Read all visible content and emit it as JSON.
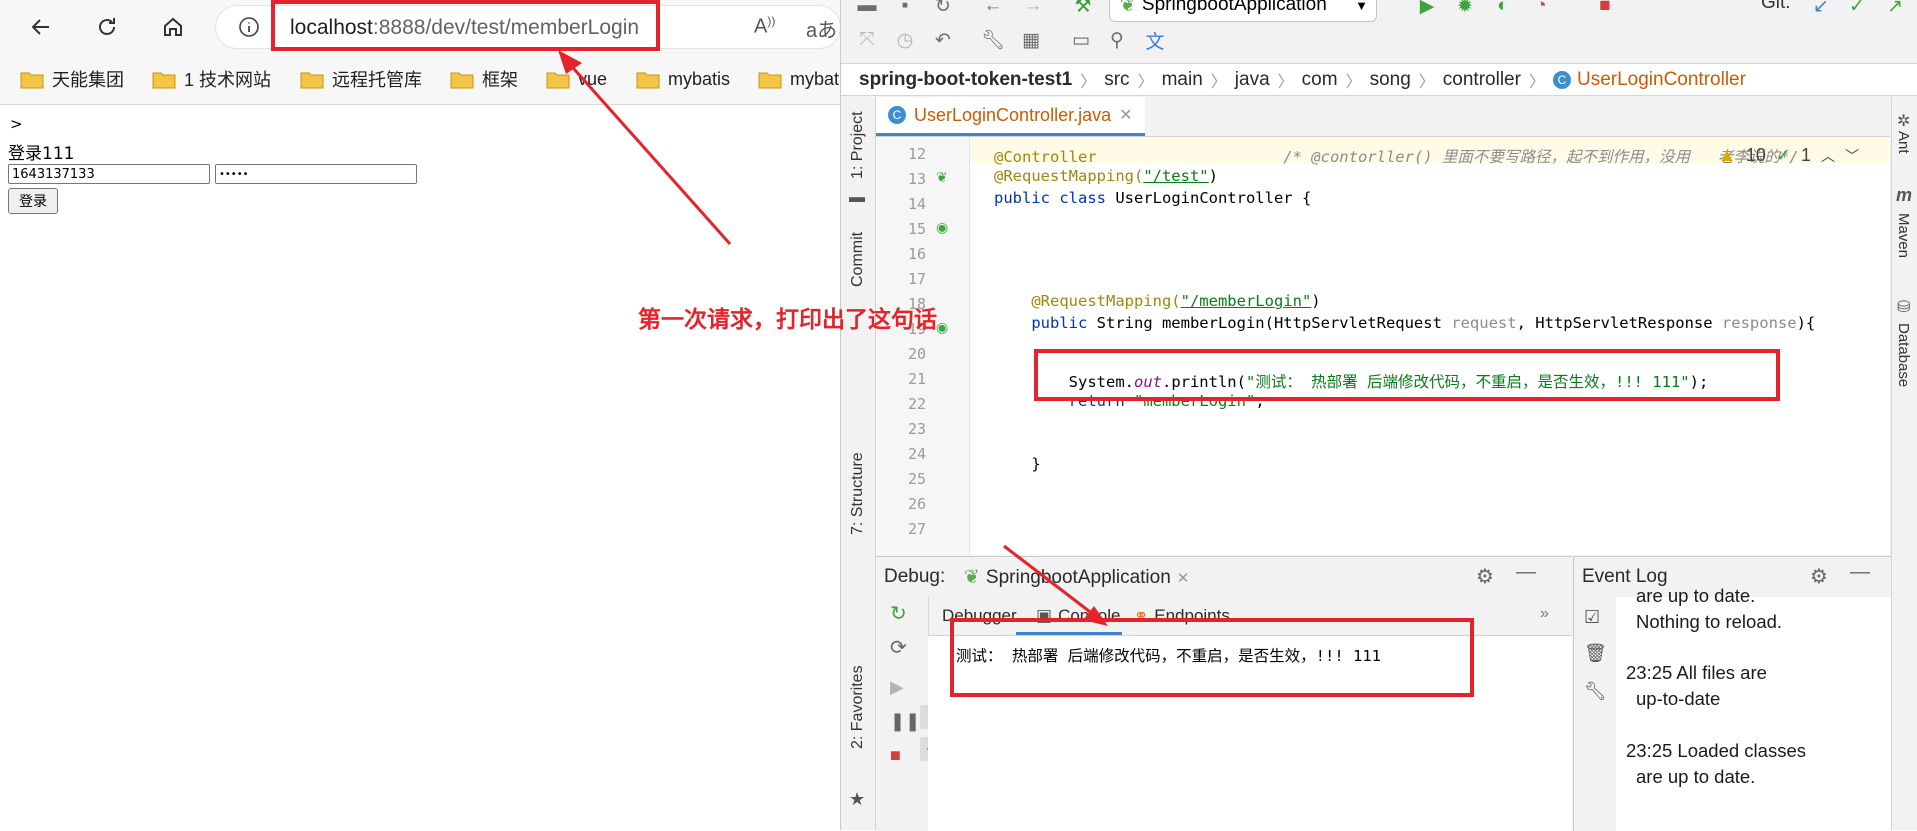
{
  "browser": {
    "address": {
      "host": "localhost",
      "path": ":8888/dev/test/memberLogin"
    },
    "bookmarks": [
      "天能集团",
      "1 技术网站",
      "远程托管库",
      "框架",
      "vue",
      "mybatis",
      "mybat"
    ],
    "page": {
      "caret": ">",
      "heading": "登录111",
      "username_value": "1643137133",
      "password_value": "•••••",
      "submit_label": "登录"
    }
  },
  "ide": {
    "run_config": "SpringbootApplication",
    "git_label": "Git:",
    "breadcrumbs": [
      "spring-boot-token-test1",
      "src",
      "main",
      "java",
      "com",
      "song",
      "controller",
      "UserLoginController"
    ],
    "left_tabs": [
      "1: Project",
      "Commit",
      "7: Structure",
      "2: Favorites"
    ],
    "right_tabs": [
      "Ant",
      "Maven",
      "Database"
    ],
    "file_tab": "UserLoginController.java",
    "inspections": {
      "warnings": "10",
      "checks": "1"
    },
    "line_numbers": [
      "12",
      "13",
      "14",
      "15",
      "16",
      "17",
      "18",
      "19",
      "20",
      "21",
      "22",
      "23",
      "24",
      "25",
      "26",
      "27"
    ],
    "code": {
      "l13_ann": "@Controller",
      "l13_comment": "/* @contorller() 里面不要写路径，起不到作用，没用   老李说的*/",
      "l14_ann": "@RequestMapping(",
      "l14_str": "\"/test\"",
      "l14_end": ")",
      "l15_kw": "public class ",
      "l15_rest": "UserLoginController {",
      "l18_ann": "@RequestMapping(",
      "l18_str": "\"/memberLogin\"",
      "l18_end": ")",
      "l19_kw": "public ",
      "l19_a": "String memberLogin(HttpServletRequest ",
      "l19_p1": "request",
      "l19_b": ", HttpServletResponse ",
      "l19_p2": "response",
      "l19_c": "){",
      "l21_a": "System.",
      "l21_out": "out",
      "l21_b": ".println(",
      "l21_str": "\"测试： 热部署 后端修改代码，不重启，是否生效，!!! 111\"",
      "l21_c": ");",
      "l22_kw": "return ",
      "l22_str": "\"memberLogin\"",
      "l22_end": ";",
      "l25": "}"
    },
    "debug": {
      "title": "Debug:",
      "session": "SpringbootApplication",
      "tabs": [
        "Debugger",
        "Console",
        "Endpoints"
      ],
      "console_output": "测试： 热部署 后端修改代码，不重启，是否生效，!!! 111"
    },
    "event_log": {
      "title": "Event Log",
      "lines": [
        "are up to date.",
        "Nothing to reload.",
        "23:25  All files are",
        "up-to-date",
        "23:25  Loaded classes",
        "are up to date."
      ]
    }
  },
  "annotation": {
    "text": "第一次请求，打印出了这句话",
    "color": "#e5232b"
  }
}
